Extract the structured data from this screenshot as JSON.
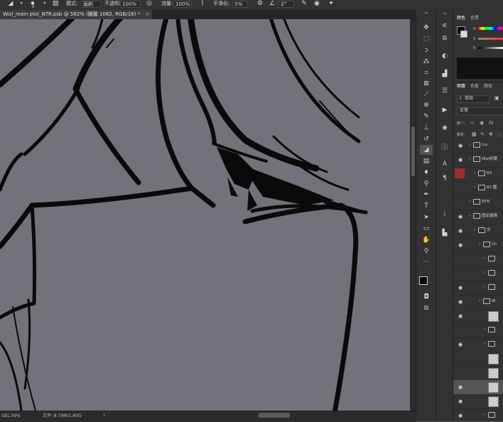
{
  "options_bar": {
    "brush_size": "9",
    "mode_label": "模式:",
    "mode_value": "画刷",
    "opacity_label": "不透明:",
    "opacity_value": "100%",
    "flow_label": "流量:",
    "flow_value": "100%",
    "smoothing_label": "平滑化:",
    "smoothing_value": "5%",
    "angle_value": "-2°"
  },
  "document_tab": {
    "title": "Wizl_main plot_NTR.psb @ 582% (圖層 1082, RGB/16) *",
    "close": "×"
  },
  "status_bar": {
    "zoom": "581.59%",
    "file_info": "文件: 8.79M/1.60G",
    "arrow": "‹"
  },
  "color_panel": {
    "tabs": [
      "颜色",
      "色票"
    ],
    "channel_labels": [
      "H",
      "S",
      "B"
    ],
    "active_color": "#f0d0d0",
    "background_color": "#1a1a1a"
  },
  "layers_panel": {
    "tabs": [
      "图層",
      "色板",
      "路徑"
    ],
    "kind_filter": "種類",
    "blend_mode": "正常",
    "unify_label": "統一:",
    "lock_label": "鎖定:",
    "layers": [
      {
        "name": "Lia",
        "type": "folder",
        "visible": true,
        "indent": 0
      },
      {
        "name": "Wizl初愛",
        "type": "folder",
        "visible": true,
        "indent": 0
      },
      {
        "name": "83",
        "type": "folder",
        "visible": false,
        "indent": 1,
        "badge": "red"
      },
      {
        "name": "82 圖",
        "type": "folder",
        "visible": false,
        "indent": 1
      },
      {
        "name": "NTR",
        "type": "folder",
        "visible": false,
        "indent": 0
      },
      {
        "name": "固定劇情",
        "type": "folder",
        "visible": true,
        "indent": 0
      },
      {
        "name": "交",
        "type": "folder",
        "visible": true,
        "indent": 1
      },
      {
        "name": "Ch",
        "type": "folder",
        "visible": true,
        "indent": 2
      },
      {
        "name": "",
        "type": "folder",
        "visible": false,
        "indent": 3
      },
      {
        "name": "",
        "type": "folder",
        "visible": false,
        "indent": 3
      },
      {
        "name": "",
        "type": "folder",
        "visible": true,
        "indent": 3
      },
      {
        "name": "W",
        "type": "folder",
        "visible": true,
        "indent": 2
      },
      {
        "name": "",
        "type": "layer",
        "visible": true,
        "indent": 3
      },
      {
        "name": "",
        "type": "folder",
        "visible": false,
        "indent": 3
      },
      {
        "name": "",
        "type": "folder",
        "visible": true,
        "indent": 3
      },
      {
        "name": "",
        "type": "layer",
        "visible": false,
        "indent": 3
      },
      {
        "name": "",
        "type": "layer",
        "visible": false,
        "indent": 3
      },
      {
        "name": "",
        "type": "layer",
        "visible": true,
        "indent": 3,
        "selected": true
      },
      {
        "name": "",
        "type": "layer",
        "visible": true,
        "indent": 3
      },
      {
        "name": "",
        "type": "folder",
        "visible": true,
        "indent": 3
      },
      {
        "name": "",
        "type": "layer",
        "visible": false,
        "indent": 3
      }
    ]
  },
  "tools": [
    "move-tool-icon",
    "marquee-tool-icon",
    "lasso-tool-icon",
    "magic-wand-icon",
    "crop-tool-icon",
    "frame-tool-icon",
    "eyedropper-icon",
    "healing-brush-icon",
    "brush-tool-icon",
    "clone-stamp-icon",
    "history-brush-icon",
    "eraser-tool-icon",
    "gradient-tool-icon",
    "blur-tool-icon",
    "dodge-tool-icon",
    "pen-tool-icon",
    "type-tool-icon",
    "path-select-icon",
    "shape-tool-icon",
    "hand-tool-icon",
    "zoom-tool-icon",
    "more-tools-icon"
  ],
  "active_tool": "eraser-tool-icon"
}
